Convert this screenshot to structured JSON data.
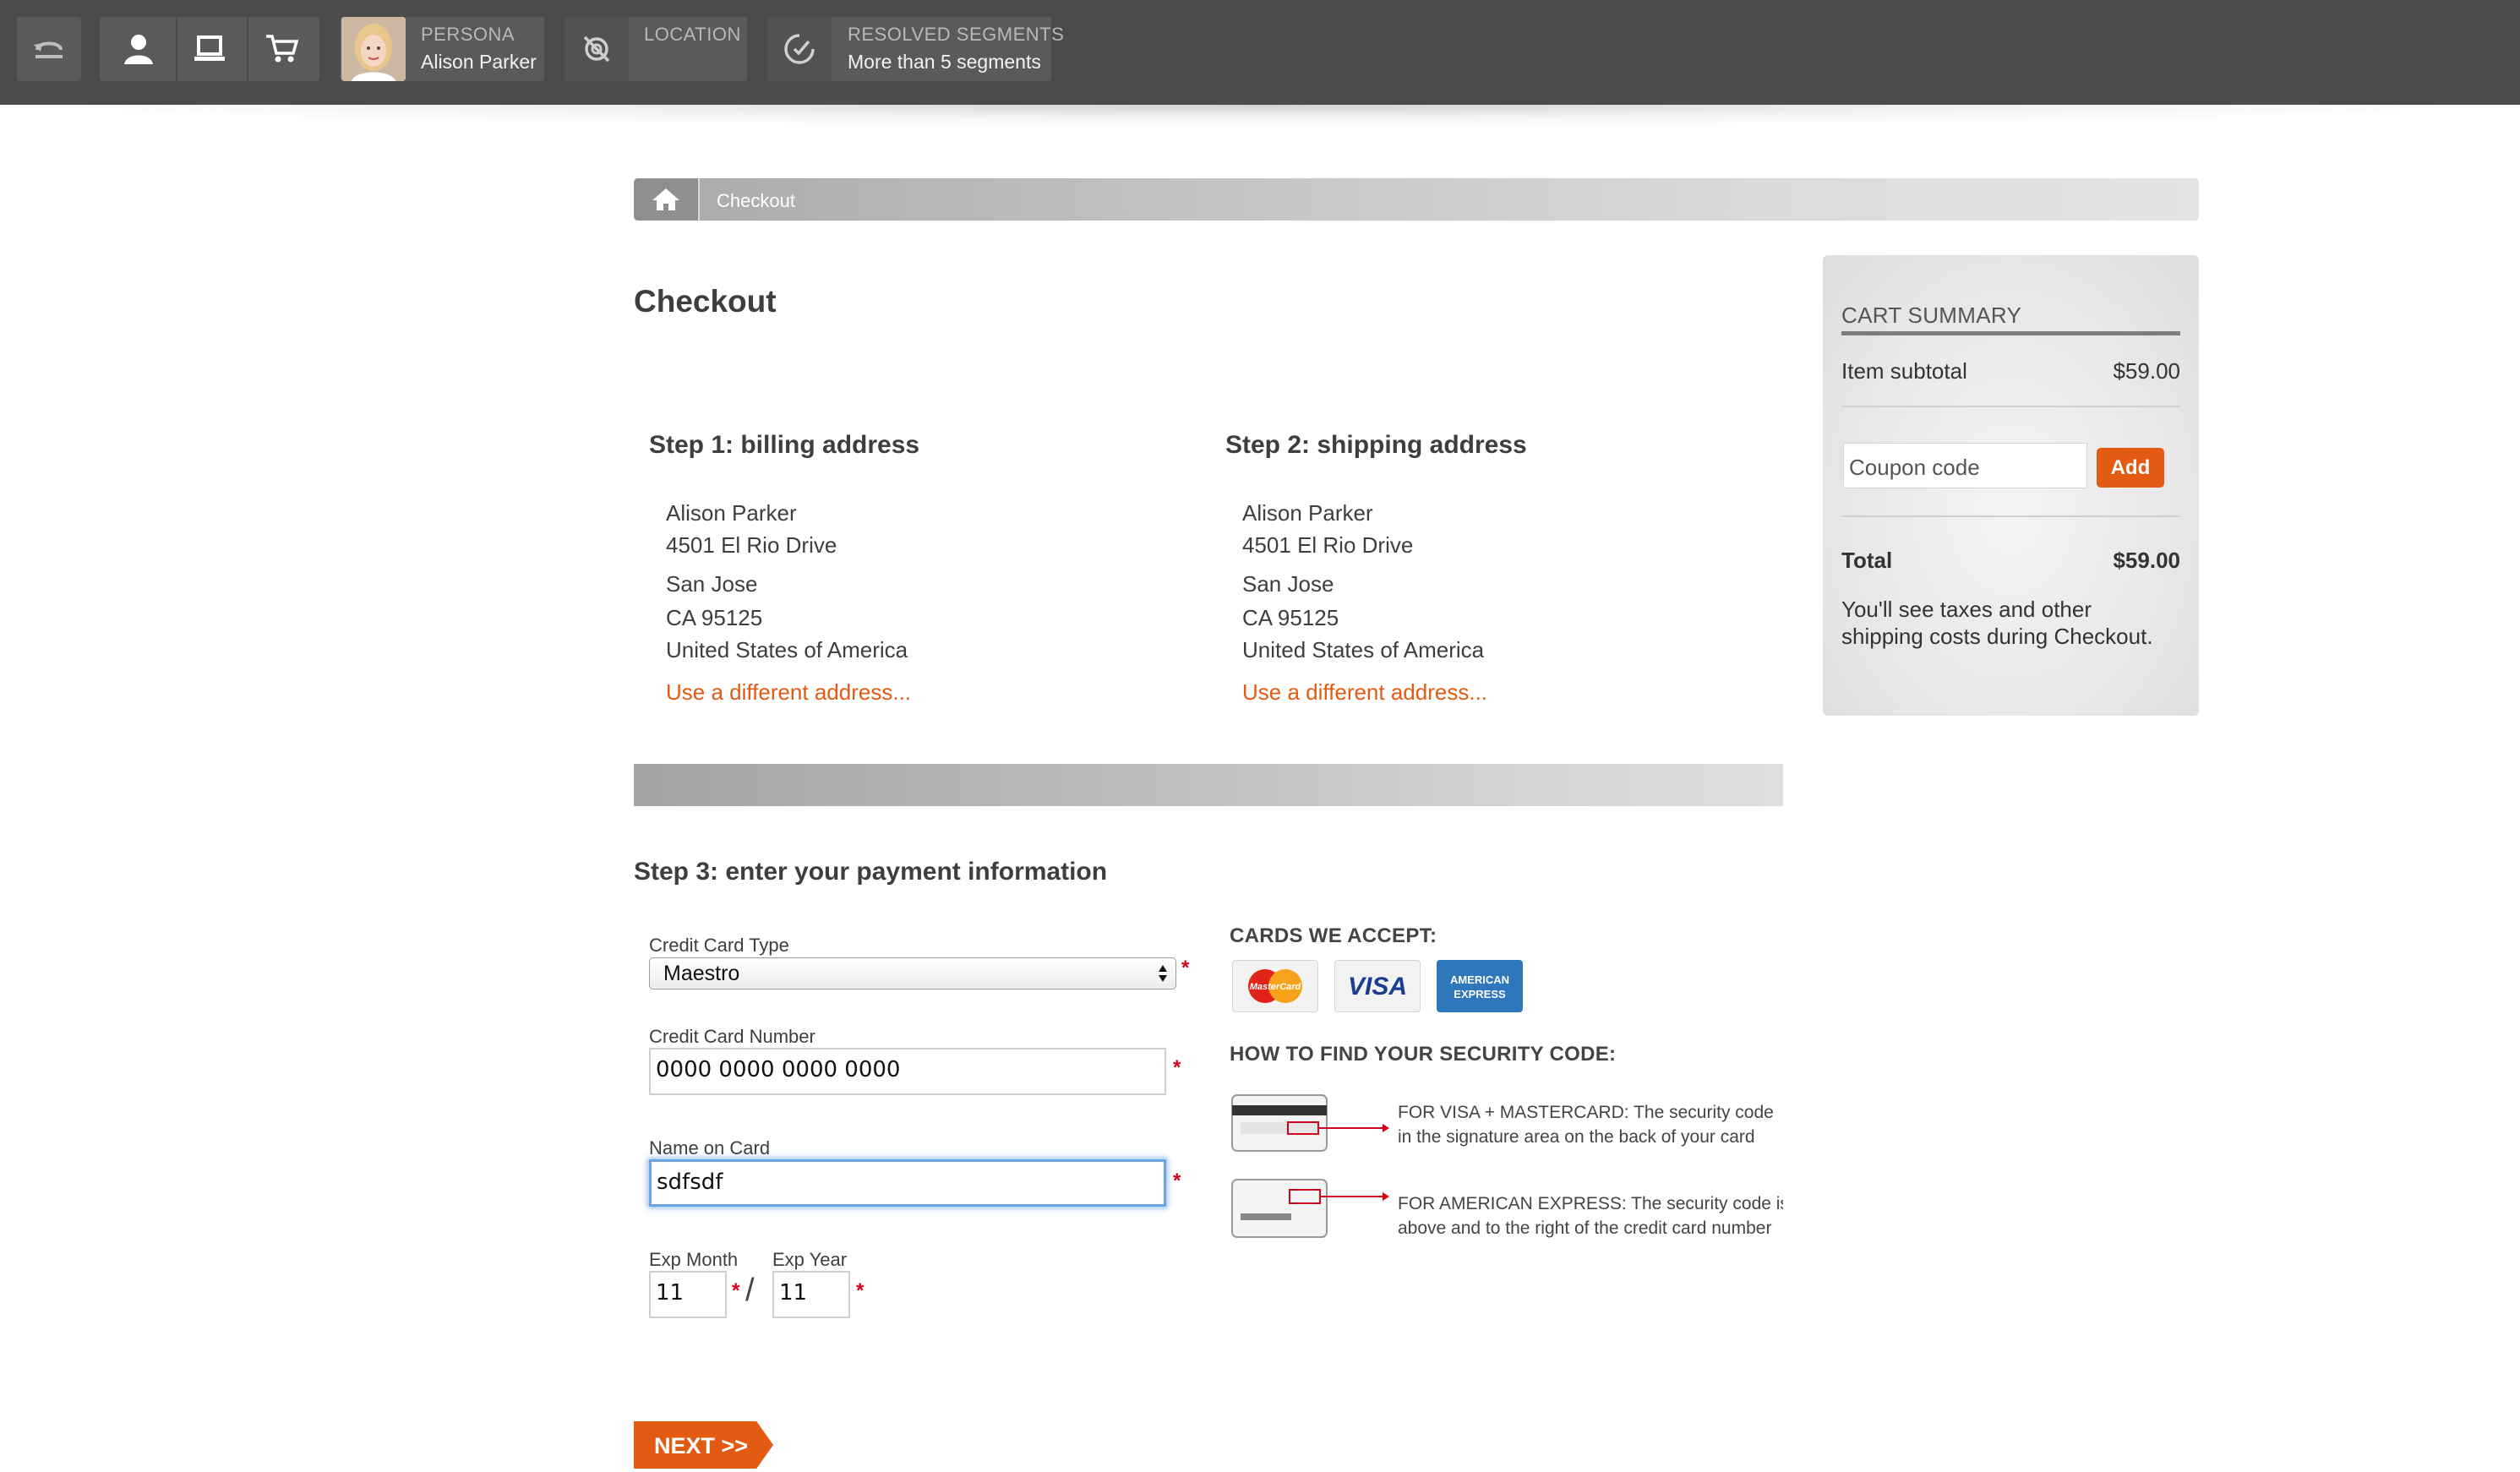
{
  "toolbar": {
    "back_icon": "undo-icon",
    "nav_icons": [
      "user-icon",
      "laptop-icon",
      "cart-icon"
    ],
    "persona": {
      "caption": "PERSONA",
      "value": "Alison Parker"
    },
    "location": {
      "caption": "LOCATION",
      "value": ""
    },
    "segments": {
      "caption": "RESOLVED SEGMENTS",
      "value": "More than 5 segments"
    }
  },
  "breadcrumb": {
    "home_icon": "home-icon",
    "current": "Checkout"
  },
  "page_title": "Checkout",
  "billing": {
    "title": "Step 1: billing address",
    "name": "Alison Parker",
    "street": "4501 El Rio Drive",
    "city": "San Jose",
    "state_zip": "CA  95125",
    "country": "United States of America",
    "change_link": "Use a different address..."
  },
  "shipping": {
    "title": "Step 2: shipping address",
    "name": "Alison Parker",
    "street": "4501 El Rio Drive",
    "city": "San Jose",
    "state_zip": "CA  95125",
    "country": "United States of America",
    "change_link": "Use a different address..."
  },
  "payment": {
    "title": "Step 3: enter your payment information",
    "card_type_label": "Credit Card Type",
    "card_type_value": "Maestro",
    "card_number_label": "Credit Card Number",
    "card_number_value": "0000 0000 0000 0000",
    "name_label": "Name on Card",
    "name_value": "sdfsdf",
    "exp_month_label": "Exp Month",
    "exp_month_value": "11",
    "exp_year_label": "Exp Year",
    "exp_year_value": "11",
    "required_mark": "*",
    "date_separator": "/",
    "next_button": "NEXT >>"
  },
  "cards_info": {
    "accept_heading": "CARDS WE ACCEPT:",
    "mastercard_text": "MasterCard",
    "visa_text": "VISA",
    "amex_text": [
      "AMERICAN",
      "EXPRESS"
    ],
    "security_heading": "HOW TO FIND YOUR SECURITY CODE:",
    "visa_mc_line1": "FOR VISA + MASTERCARD: The security code",
    "visa_mc_line2": "in the signature area on the back of your card",
    "amex_line1": "FOR AMERICAN EXPRESS: The security code is",
    "amex_line2": "above and to the right of the credit card number"
  },
  "cart": {
    "heading": "CART SUMMARY",
    "subtotal_label": "Item subtotal",
    "subtotal_value": "$59.00",
    "coupon_placeholder": "Coupon code",
    "add_button": "Add",
    "total_label": "Total",
    "total_value": "$59.00",
    "note_line1": "You'll see taxes and other",
    "note_line2": "shipping costs during Checkout."
  },
  "colors": {
    "toolbar_bg": "#4b4b4b",
    "accent_orange": "#e35a13",
    "required_red": "#d0021b",
    "focus_blue": "#6aa3e8"
  }
}
